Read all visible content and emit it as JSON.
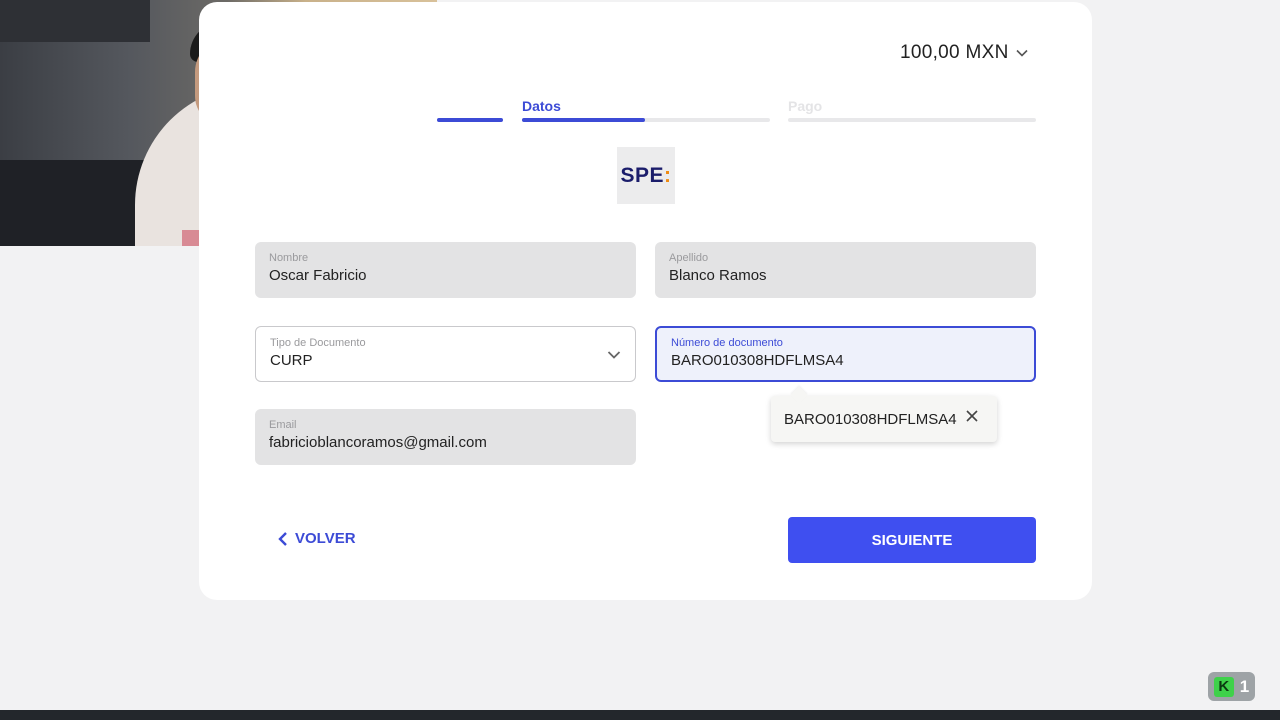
{
  "header": {
    "amount": "100,00 MXN"
  },
  "steps": [
    {
      "label": "Datos",
      "state": "active"
    },
    {
      "label": "Pago",
      "state": "inactive"
    }
  ],
  "logo": {
    "text_main": "SPE",
    "text_accent": ":"
  },
  "form": {
    "nombre": {
      "label": "Nombre",
      "value": "Oscar Fabricio"
    },
    "apellido": {
      "label": "Apellido",
      "value": "Blanco Ramos"
    },
    "tipo_documento": {
      "label": "Tipo de Documento",
      "value": "CURP"
    },
    "numero_documento": {
      "label": "Número de documento",
      "value": "BARO010308HDFLMSA4"
    },
    "email": {
      "label": "Email",
      "value": "fabricioblancoramos@gmail.com"
    }
  },
  "autocomplete": {
    "suggestion": "BARO010308HDFLMSA4"
  },
  "actions": {
    "back_label": "VOLVER",
    "next_label": "SIGUIENTE"
  },
  "overlay_badge": {
    "count": "1"
  },
  "colors": {
    "accent": "#3c4bd6",
    "button": "#3f4ff0"
  }
}
